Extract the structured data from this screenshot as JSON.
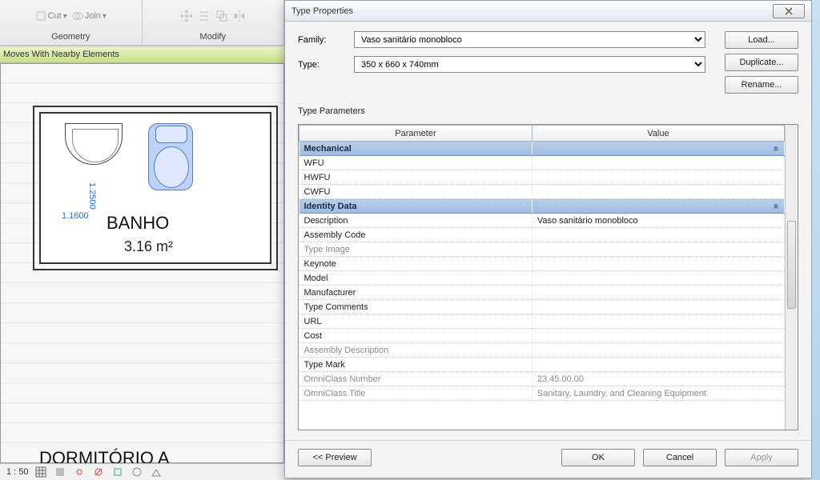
{
  "ribbon": {
    "geometry_label": "Geometry",
    "modify_label": "Modify",
    "cut_label": "Cut",
    "join_label": "Join"
  },
  "optionsbar": {
    "text": "Moves With Nearby Elements"
  },
  "canvas": {
    "dim1": "1.1600",
    "dim2": "1.2500",
    "room_name": "BANHO",
    "room_area": "3.16 m²",
    "lower_room": "DORMITÓRIO A"
  },
  "status": {
    "scale": "1 : 50"
  },
  "dialog": {
    "title": "Type Properties",
    "family_label": "Family:",
    "type_label": "Type:",
    "family_selected": "Vaso sanitário monobloco",
    "type_selected": "350 x 660 x 740mm",
    "btn_load": "Load...",
    "btn_duplicate": "Duplicate...",
    "btn_rename": "Rename...",
    "tp_label": "Type Parameters",
    "col_parameter": "Parameter",
    "col_value": "Value",
    "cat_mechanical": "Mechanical",
    "cat_identity": "Identity Data",
    "rows": {
      "wfu": "WFU",
      "hwfu": "HWFU",
      "cwfu": "CWFU",
      "description": "Description",
      "description_val": "Vaso sanitário monobloco",
      "assembly_code": "Assembly Code",
      "type_image": "Type Image",
      "keynote": "Keynote",
      "model": "Model",
      "manufacturer": "Manufacturer",
      "type_comments": "Type Comments",
      "url": "URL",
      "cost": "Cost",
      "assembly_desc": "Assembly Description",
      "type_mark": "Type Mark",
      "omni_num": "OmniClass Number",
      "omni_num_val": "23.45.00.00",
      "omni_title": "OmniClass Title",
      "omni_title_val": "Sanitary, Laundry, and Cleaning Equipment"
    },
    "btn_preview": "<< Preview",
    "btn_ok": "OK",
    "btn_cancel": "Cancel",
    "btn_apply": "Apply"
  }
}
